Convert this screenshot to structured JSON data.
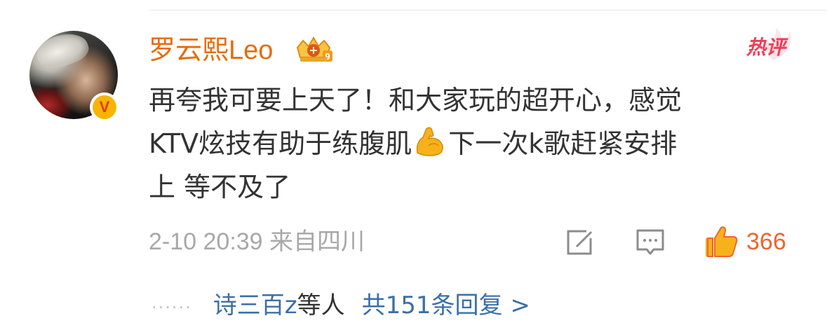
{
  "comment": {
    "username": "罗云熙Leo",
    "member_icon": "crown-member-icon",
    "verified_badge": "V",
    "hot_label": "热评",
    "lines": [
      "再夸我可要上天了！和大家玩的超开心，感觉",
      "KTV炫技有助于练腹肌",
      "下一次k歌赶紧安排",
      "上 等不及了"
    ],
    "emoji": "flexed-biceps-icon",
    "time": "2-10 20:39",
    "location": "来自四川",
    "like_count": "366",
    "repost_icon": "repost-icon",
    "reply_icon": "comment-icon",
    "like_icon": "thumbs-up-icon"
  },
  "replies": {
    "dots": "......",
    "names": "诗三百z",
    "suffix": "等人",
    "total": "共151条回复 >"
  },
  "colors": {
    "username": "#e86b0c",
    "hot": "#f23c57",
    "link": "#3b6fa8",
    "like": "#f0652d",
    "meta": "#a8a8a8",
    "text": "#333333"
  }
}
